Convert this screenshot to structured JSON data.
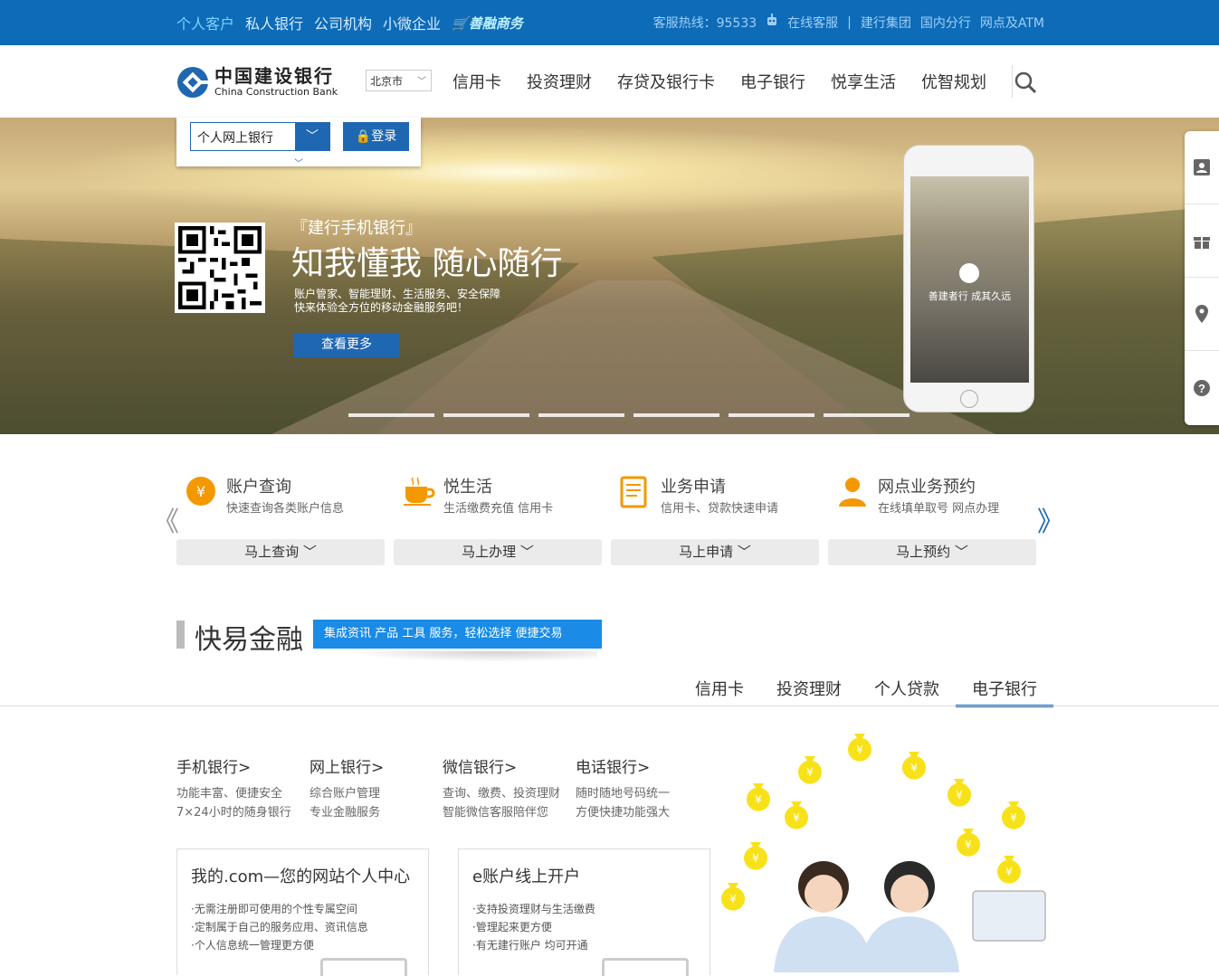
{
  "topbar": {
    "segments": [
      "个人客户",
      "私人银行",
      "公司机构",
      "小微企业"
    ],
    "shop": "善融商务",
    "hotline": "客服热线：95533",
    "online_service": "在线客服",
    "divider": "|",
    "links": [
      "建行集团",
      "国内分行",
      "网点及ATM"
    ]
  },
  "header": {
    "logo_cn": "中国建设银行",
    "logo_en": "China Construction Bank",
    "city": "北京市",
    "nav": [
      "信用卡",
      "投资理财",
      "存贷及银行卡",
      "电子银行",
      "悦享生活",
      "优智规划"
    ]
  },
  "login": {
    "select_value": "个人网上银行",
    "button": "登录"
  },
  "banner": {
    "subtitle": "『建行手机银行』",
    "title": "知我懂我 随心随行",
    "desc_line1": "账户管家、智能理财、生活服务、安全保障",
    "desc_line2": "快来体验全方位的移动金融服务吧！",
    "more_button": "查看更多",
    "phone_slogan": "善建者行 成其久远",
    "slide_count": 6
  },
  "services": [
    {
      "title": "账户查询",
      "desc": "快速查询各类账户信息",
      "button": "马上查询",
      "icon": "yuan-coin-icon"
    },
    {
      "title": "悦生活",
      "desc": "生活缴费充值 信用卡",
      "button": "马上办理",
      "icon": "coffee-cup-icon"
    },
    {
      "title": "业务申请",
      "desc": "信用卡、贷款快速申请",
      "button": "马上申请",
      "icon": "document-icon"
    },
    {
      "title": "网点业务预约",
      "desc": "在线填单取号 网点办理",
      "button": "马上预约",
      "icon": "person-icon"
    }
  ],
  "quick_finance": {
    "title": "快易金融",
    "tag": "集成资讯 产品 工具 服务，轻松选择 便捷交易",
    "tabs": [
      "信用卡",
      "投资理财",
      "个人贷款",
      "电子银行"
    ],
    "active_tab": "电子银行"
  },
  "ebank": [
    {
      "title": "手机银行>",
      "line1": "功能丰富、便捷安全",
      "line2": "7×24小时的随身银行"
    },
    {
      "title": "网上银行>",
      "line1": "综合账户管理",
      "line2": "专业金融服务"
    },
    {
      "title": "微信银行>",
      "line1": "查询、缴费、投资理财",
      "line2": "智能微信客服陪伴您"
    },
    {
      "title": "电话银行>",
      "line1": "随时随地号码统一",
      "line2": "方便快捷功能强大"
    }
  ],
  "cards": [
    {
      "title": "我的.com—您的网站个人中心",
      "items": [
        "·无需注册即可使用的个性专属空间",
        "·定制属于自己的服务应用、资讯信息",
        "·个人信息统一管理更方便"
      ]
    },
    {
      "title": "e账户线上开户",
      "items": [
        "·支持投资理财与生活缴费",
        "·管理起来更方便",
        "·有无建行账户 均可开通"
      ]
    }
  ],
  "colors": {
    "topbar_bg": "#0e6bb8",
    "brand_blue": "#1f67b1",
    "tag_blue": "#1a8be6",
    "icon_orange": "#f39800"
  }
}
